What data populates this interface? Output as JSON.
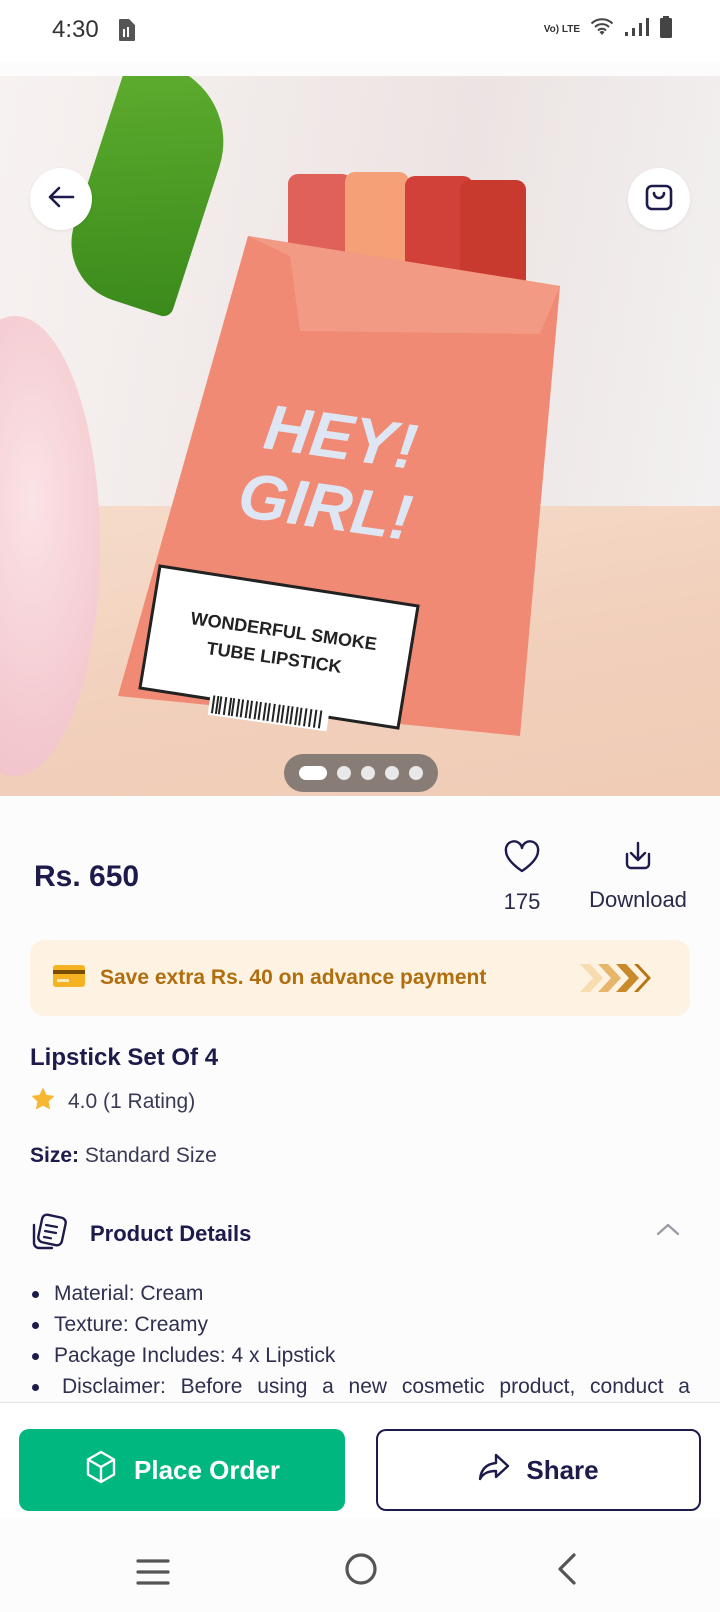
{
  "status_bar": {
    "time": "4:30",
    "network_label": "Vo) LTE"
  },
  "hero": {
    "box_headline_1": "HEY!",
    "box_headline_2": "GIRL!",
    "box_label_1": "WONDERFUL SMOKE",
    "box_label_2": "TUBE LIPSTICK",
    "image_count": 5,
    "active_image": 1
  },
  "product": {
    "price": "Rs. 650",
    "wishlist_count": "175",
    "download_label": "Download",
    "promo_text": "Save extra Rs. 40 on advance payment",
    "title": "Lipstick Set Of 4",
    "rating_text": "4.0 (1 Rating)",
    "size_label": "Size:",
    "size_value": "Standard Size"
  },
  "details": {
    "heading": "Product Details",
    "items": [
      "Material: Cream",
      "Texture: Creamy",
      "Package Includes: 4 x Lipstick",
      "Disclaimer: Before using a new cosmetic product, conduct a"
    ]
  },
  "actions": {
    "order_label": "Place Order",
    "share_label": "Share"
  },
  "colors": {
    "primary": "#00b77f",
    "text_dark": "#1c1b4b",
    "promo_bg": "#fef3e2",
    "promo_text": "#b06e0e",
    "star": "#f7b733"
  }
}
